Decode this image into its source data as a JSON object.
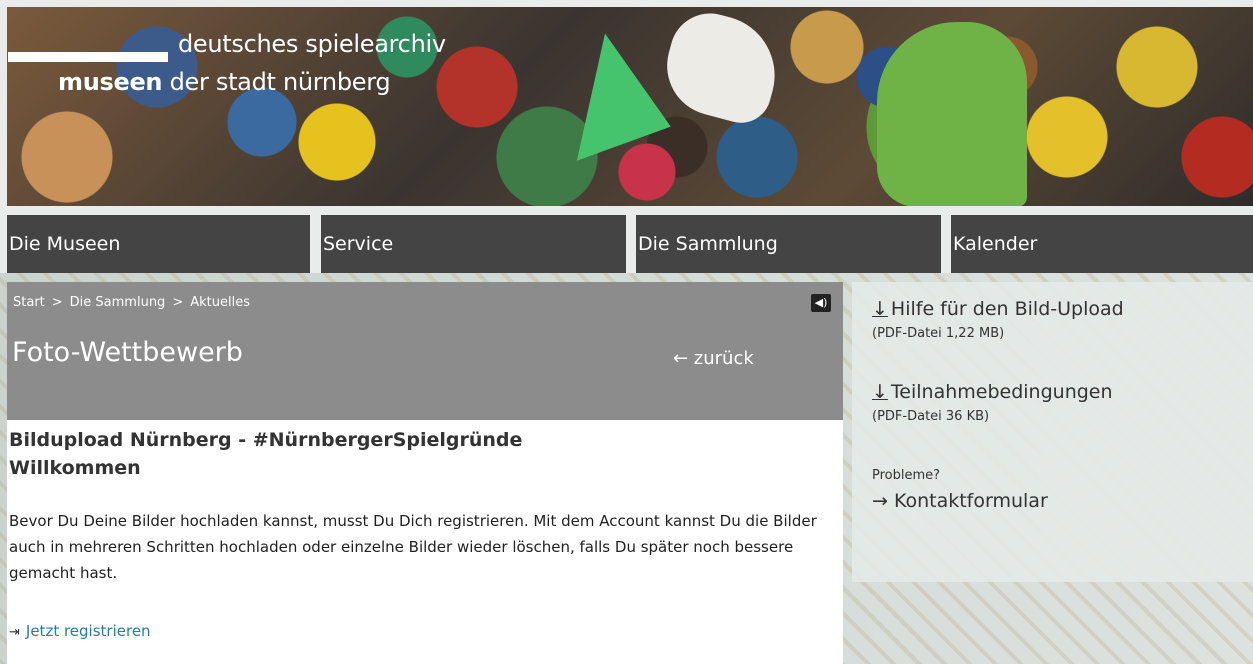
{
  "logo": {
    "line1": "deutsches spielearchiv",
    "line2_bold": "museen",
    "line2_rest": " der stadt nürnberg"
  },
  "nav": [
    {
      "label": "Die Museen"
    },
    {
      "label": "Service"
    },
    {
      "label": "Die Sammlung"
    },
    {
      "label": "Kalender"
    }
  ],
  "breadcrumb": [
    "Start",
    "Die Sammlung",
    "Aktuelles"
  ],
  "breadcrumb_sep": ">",
  "speaker_icon": "speaker-icon",
  "page_title": "Foto-Wettbewerb",
  "back_link": "← zurück",
  "main": {
    "heading_line1": "Bildupload Nürnberg - #NürnbergerSpielgründe",
    "heading_line2": "Willkommen",
    "paragraph": "Bevor Du Deine Bilder hochladen kannst, musst Du Dich registrieren. Mit dem Account kannst Du die Bilder auch in mehreren Schritten hochladen oder einzelne Bilder wieder löschen, falls Du später noch bessere gemacht hast.",
    "register_icon": "login-icon",
    "register_link": "Jetzt registrieren"
  },
  "sidebar": {
    "download1": {
      "arrow": "↓",
      "label": "Hilfe für den Bild-Upload",
      "meta": "(PDF-Datei 1,22 MB)"
    },
    "download2": {
      "arrow": "↓",
      "label": "Teilnahmebedingungen",
      "meta": "(PDF-Datei 36 KB)"
    },
    "problems_label": "Probleme?",
    "contact_link": "→ Kontaktformular"
  },
  "colors": {
    "nav_bg": "#444444",
    "header_panel": "#8c8c8c",
    "link": "#1f7fa3"
  }
}
